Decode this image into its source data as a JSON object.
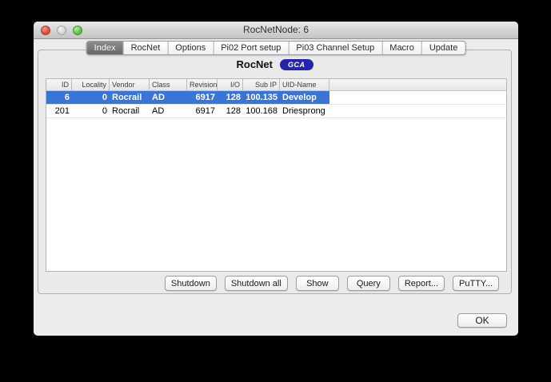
{
  "window": {
    "title": "RocNetNode: 6"
  },
  "traffic_lights": [
    "close-icon",
    "minimize-icon",
    "zoom-icon"
  ],
  "tabs": [
    {
      "label": "Index",
      "selected": true
    },
    {
      "label": "RocNet",
      "selected": false
    },
    {
      "label": "Options",
      "selected": false
    },
    {
      "label": "Pi02 Port setup",
      "selected": false
    },
    {
      "label": "Pi03 Channel Setup",
      "selected": false
    },
    {
      "label": "Macro",
      "selected": false
    },
    {
      "label": "Update",
      "selected": false
    }
  ],
  "panel": {
    "heading": "RocNet",
    "badge": "GCA"
  },
  "table": {
    "columns": [
      {
        "label": "ID",
        "align": "right"
      },
      {
        "label": "Locality",
        "align": "right"
      },
      {
        "label": "Vendor",
        "align": "left"
      },
      {
        "label": "Class",
        "align": "left"
      },
      {
        "label": "Revision",
        "align": "right"
      },
      {
        "label": "I/O",
        "align": "right"
      },
      {
        "label": "Sub IP",
        "align": "right"
      },
      {
        "label": "UID-Name",
        "align": "left"
      }
    ],
    "rows": [
      {
        "selected": true,
        "cells": [
          "6",
          "0",
          "Rocrail",
          "AD",
          "6917",
          "128",
          "100.135",
          "Develop"
        ]
      },
      {
        "selected": false,
        "cells": [
          "201",
          "0",
          "Rocrail",
          "AD",
          "6917",
          "128",
          "100.168",
          "Driesprong"
        ]
      }
    ]
  },
  "buttons": [
    {
      "label": "Shutdown"
    },
    {
      "label": "Shutdown all"
    },
    {
      "label": "Show"
    },
    {
      "label": "Query"
    },
    {
      "label": "Report..."
    },
    {
      "label": "PuTTY..."
    }
  ],
  "ok_button": {
    "label": "OK"
  },
  "colors": {
    "selection_blue": "#3875d7",
    "badge_blue": "#2525ac",
    "selected_tab_gray": "#787878",
    "window_bg": "#ececec"
  }
}
